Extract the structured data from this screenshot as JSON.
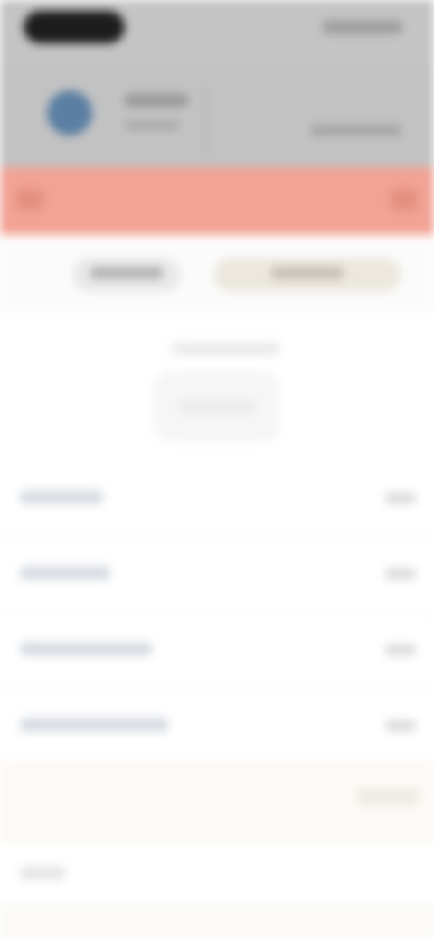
{
  "header": {
    "name": "",
    "subtitle": "",
    "right_text": ""
  },
  "tab_bar": {
    "title": ""
  },
  "segments": {
    "left": "",
    "right": ""
  },
  "center": {
    "line1": "",
    "line2": ""
  },
  "list": {
    "rows": [
      {
        "label": "",
        "value": ""
      },
      {
        "label": "",
        "value": ""
      },
      {
        "label": "",
        "value": ""
      },
      {
        "label": "",
        "value": ""
      }
    ]
  },
  "notice": {
    "button": ""
  },
  "footer": {
    "label": ""
  },
  "colors": {
    "accent": "#f2a395",
    "header_bg": "#c2c2c2"
  }
}
